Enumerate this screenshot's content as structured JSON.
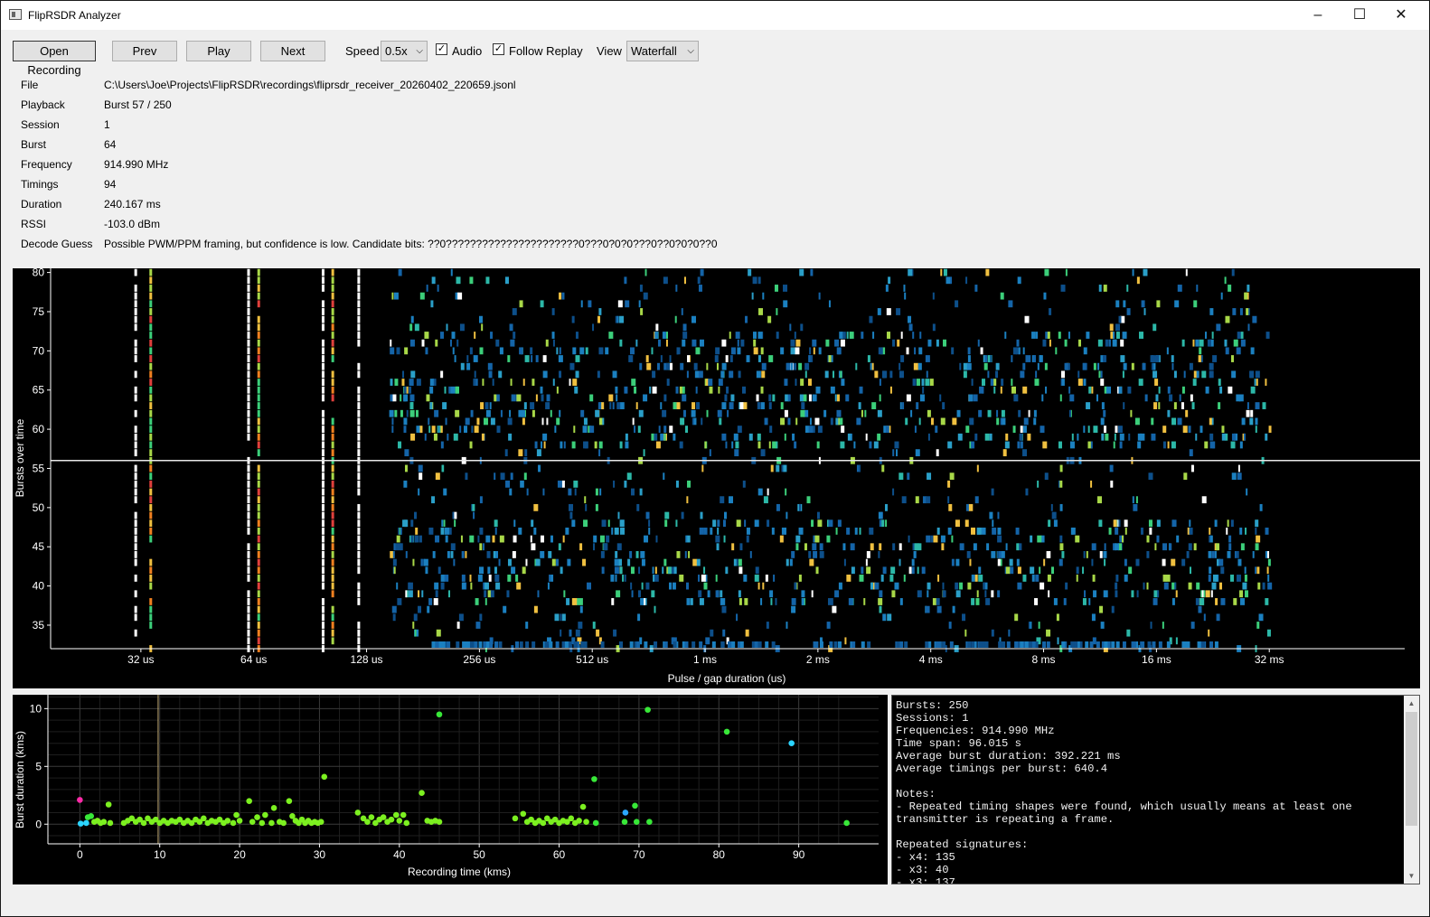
{
  "window": {
    "title": "FlipRSDR Analyzer",
    "minimize_glyph": "–",
    "maximize_glyph": "☐",
    "close_glyph": "✕"
  },
  "toolbar": {
    "open_label": "Open Recording",
    "prev_label": "Prev",
    "play_label": "Play",
    "next_label": "Next",
    "speed_label": "Speed",
    "speed_value": "0.5x",
    "audio_label": "Audio",
    "audio_checked": true,
    "follow_label": "Follow Replay",
    "follow_checked": true,
    "view_label": "View",
    "view_value": "Waterfall",
    "check_glyph": "✓",
    "dropdown_glyph": "⌵"
  },
  "info": {
    "file_label": "File",
    "file_value": "C:\\Users\\Joe\\Projects\\FlipRSDR\\recordings\\fliprsdr_receiver_20260402_220659.jsonl",
    "playback_label": "Playback",
    "playback_value": "Burst 57 / 250",
    "session_label": "Session",
    "session_value": "1",
    "burst_label": "Burst",
    "burst_value": "64",
    "frequency_label": "Frequency",
    "frequency_value": "914.990 MHz",
    "timings_label": "Timings",
    "timings_value": "94",
    "duration_label": "Duration",
    "duration_value": "240.167 ms",
    "rssi_label": "RSSI",
    "rssi_value": "-103.0 dBm",
    "decode_label": "Decode Guess",
    "decode_value": "Possible PWM/PPM framing, but confidence is low. Candidate bits: ??0??????????????????????0???0?0?0???0??0?0?0??0"
  },
  "waterfall": {
    "ylabel": "Bursts over time",
    "xlabel": "Pulse / gap duration (us)",
    "y_ticks": [
      "35",
      "40",
      "45",
      "50",
      "55",
      "60",
      "65",
      "70",
      "75",
      "80"
    ],
    "y_range": [
      32,
      80.3
    ],
    "x_ticks": [
      "32 us",
      "64 us",
      "128 us",
      "256 us",
      "512 us",
      "1 ms",
      "2 ms",
      "4 ms",
      "8 ms",
      "16 ms",
      "32 ms"
    ],
    "x_range_log2_us": [
      4.2,
      16.2
    ],
    "current_burst": 56,
    "colors": [
      "#0d4f8a",
      "#1464a8",
      "#1b80c0",
      "#2a9fc8",
      "#2cb8a8",
      "#3ccf7a",
      "#a8d848",
      "#f0c040",
      "#f08020",
      "#e0403c",
      "#ffffff"
    ]
  },
  "chart_data": [
    {
      "type": "heatmap",
      "title": "",
      "xlabel": "Pulse / gap duration (us)",
      "ylabel": "Bursts over time",
      "x_scale": "log2",
      "x_tick_labels": [
        "32 us",
        "64 us",
        "128 us",
        "256 us",
        "512 us",
        "1 ms",
        "2 ms",
        "4 ms",
        "8 ms",
        "16 ms",
        "32 ms"
      ],
      "y_range": [
        32,
        80
      ],
      "highlighted_burst": 56,
      "strong_columns_us": [
        31,
        34,
        62,
        66,
        98,
        104,
        122
      ]
    },
    {
      "type": "scatter",
      "title": "",
      "xlabel": "Recording time (kms)",
      "ylabel": "Burst duration (kms)",
      "xlim": [
        -4,
        100
      ],
      "ylim": [
        -1.7,
        11.2
      ],
      "x_ticks": [
        0,
        10,
        20,
        30,
        40,
        50,
        60,
        70,
        80,
        90
      ],
      "y_ticks": [
        0,
        5,
        10
      ],
      "cursor_x": 9.8,
      "points": [
        {
          "x": 0.0,
          "y": 2.1,
          "c": "#ff2aa8"
        },
        {
          "x": 0.1,
          "y": 0.05,
          "c": "#2bd4ff"
        },
        {
          "x": 0.8,
          "y": 0.1,
          "c": "#2bd4ff"
        },
        {
          "x": 1.0,
          "y": 0.6,
          "c": "#38e838"
        },
        {
          "x": 1.4,
          "y": 0.7,
          "c": "#38e838"
        },
        {
          "x": 1.8,
          "y": 0.2,
          "c": "#7cf020"
        },
        {
          "x": 2.2,
          "y": 0.3,
          "c": "#7cf020"
        },
        {
          "x": 2.6,
          "y": 0.1,
          "c": "#7cf020"
        },
        {
          "x": 3.0,
          "y": 0.2,
          "c": "#7cf020"
        },
        {
          "x": 3.6,
          "y": 1.7,
          "c": "#7cf020"
        },
        {
          "x": 3.8,
          "y": 0.1,
          "c": "#7cf020"
        },
        {
          "x": 5.5,
          "y": 0.1,
          "c": "#7cf020"
        },
        {
          "x": 6.0,
          "y": 0.3,
          "c": "#7cf020"
        },
        {
          "x": 6.5,
          "y": 0.5,
          "c": "#7cf020"
        },
        {
          "x": 7.0,
          "y": 0.2,
          "c": "#7cf020"
        },
        {
          "x": 7.5,
          "y": 0.4,
          "c": "#7cf020"
        },
        {
          "x": 8.0,
          "y": 0.1,
          "c": "#7cf020"
        },
        {
          "x": 8.5,
          "y": 0.5,
          "c": "#7cf020"
        },
        {
          "x": 9.0,
          "y": 0.2,
          "c": "#7cf020"
        },
        {
          "x": 9.5,
          "y": 0.4,
          "c": "#7cf020"
        },
        {
          "x": 10.0,
          "y": 0.1,
          "c": "#7cf020"
        },
        {
          "x": 10.5,
          "y": 0.3,
          "c": "#7cf020"
        },
        {
          "x": 11.0,
          "y": 0.1,
          "c": "#7cf020"
        },
        {
          "x": 11.5,
          "y": 0.3,
          "c": "#7cf020"
        },
        {
          "x": 12.0,
          "y": 0.2,
          "c": "#7cf020"
        },
        {
          "x": 12.5,
          "y": 0.4,
          "c": "#7cf020"
        },
        {
          "x": 13.0,
          "y": 0.1,
          "c": "#7cf020"
        },
        {
          "x": 13.5,
          "y": 0.3,
          "c": "#7cf020"
        },
        {
          "x": 14.0,
          "y": 0.1,
          "c": "#7cf020"
        },
        {
          "x": 14.5,
          "y": 0.4,
          "c": "#7cf020"
        },
        {
          "x": 15.0,
          "y": 0.2,
          "c": "#7cf020"
        },
        {
          "x": 15.5,
          "y": 0.5,
          "c": "#7cf020"
        },
        {
          "x": 16.0,
          "y": 0.1,
          "c": "#7cf020"
        },
        {
          "x": 16.5,
          "y": 0.3,
          "c": "#7cf020"
        },
        {
          "x": 17.0,
          "y": 0.2,
          "c": "#7cf020"
        },
        {
          "x": 17.5,
          "y": 0.4,
          "c": "#7cf020"
        },
        {
          "x": 18.0,
          "y": 0.1,
          "c": "#7cf020"
        },
        {
          "x": 18.5,
          "y": 0.3,
          "c": "#7cf020"
        },
        {
          "x": 19.2,
          "y": 0.1,
          "c": "#7cf020"
        },
        {
          "x": 19.6,
          "y": 0.8,
          "c": "#7cf020"
        },
        {
          "x": 20.0,
          "y": 0.3,
          "c": "#7cf020"
        },
        {
          "x": 21.2,
          "y": 2.0,
          "c": "#7cf020"
        },
        {
          "x": 21.6,
          "y": 0.2,
          "c": "#7cf020"
        },
        {
          "x": 22.2,
          "y": 0.6,
          "c": "#7cf020"
        },
        {
          "x": 22.8,
          "y": 0.1,
          "c": "#7cf020"
        },
        {
          "x": 23.2,
          "y": 0.8,
          "c": "#7cf020"
        },
        {
          "x": 24.0,
          "y": 0.1,
          "c": "#7cf020"
        },
        {
          "x": 24.3,
          "y": 1.4,
          "c": "#7cf020"
        },
        {
          "x": 25.0,
          "y": 0.2,
          "c": "#7cf020"
        },
        {
          "x": 25.5,
          "y": 0.1,
          "c": "#7cf020"
        },
        {
          "x": 26.2,
          "y": 2.0,
          "c": "#7cf020"
        },
        {
          "x": 26.6,
          "y": 0.7,
          "c": "#7cf020"
        },
        {
          "x": 27.0,
          "y": 0.3,
          "c": "#7cf020"
        },
        {
          "x": 27.4,
          "y": 0.1,
          "c": "#7cf020"
        },
        {
          "x": 27.8,
          "y": 0.4,
          "c": "#7cf020"
        },
        {
          "x": 28.2,
          "y": 0.1,
          "c": "#7cf020"
        },
        {
          "x": 28.6,
          "y": 0.3,
          "c": "#7cf020"
        },
        {
          "x": 29.0,
          "y": 0.1,
          "c": "#7cf020"
        },
        {
          "x": 29.4,
          "y": 0.2,
          "c": "#7cf020"
        },
        {
          "x": 29.8,
          "y": 0.1,
          "c": "#7cf020"
        },
        {
          "x": 30.2,
          "y": 0.2,
          "c": "#7cf020"
        },
        {
          "x": 30.6,
          "y": 4.1,
          "c": "#7cf020"
        },
        {
          "x": 34.8,
          "y": 1.0,
          "c": "#7cf020"
        },
        {
          "x": 35.5,
          "y": 0.5,
          "c": "#7cf020"
        },
        {
          "x": 36.0,
          "y": 0.2,
          "c": "#7cf020"
        },
        {
          "x": 36.5,
          "y": 0.6,
          "c": "#7cf020"
        },
        {
          "x": 37.0,
          "y": 0.1,
          "c": "#7cf020"
        },
        {
          "x": 37.5,
          "y": 0.4,
          "c": "#7cf020"
        },
        {
          "x": 38.0,
          "y": 0.6,
          "c": "#7cf020"
        },
        {
          "x": 38.5,
          "y": 0.2,
          "c": "#7cf020"
        },
        {
          "x": 39.0,
          "y": 0.4,
          "c": "#7cf020"
        },
        {
          "x": 39.6,
          "y": 0.8,
          "c": "#7cf020"
        },
        {
          "x": 40.0,
          "y": 0.3,
          "c": "#7cf020"
        },
        {
          "x": 40.5,
          "y": 0.8,
          "c": "#7cf020"
        },
        {
          "x": 40.9,
          "y": 0.1,
          "c": "#7cf020"
        },
        {
          "x": 42.8,
          "y": 2.7,
          "c": "#7cf020"
        },
        {
          "x": 43.5,
          "y": 0.3,
          "c": "#7cf020"
        },
        {
          "x": 44.0,
          "y": 0.2,
          "c": "#7cf020"
        },
        {
          "x": 44.5,
          "y": 0.3,
          "c": "#7cf020"
        },
        {
          "x": 45.0,
          "y": 0.2,
          "c": "#7cf020"
        },
        {
          "x": 45.0,
          "y": 9.5,
          "c": "#38e838"
        },
        {
          "x": 54.5,
          "y": 0.5,
          "c": "#7cf020"
        },
        {
          "x": 55.5,
          "y": 0.9,
          "c": "#7cf020"
        },
        {
          "x": 56.0,
          "y": 0.2,
          "c": "#7cf020"
        },
        {
          "x": 56.5,
          "y": 0.4,
          "c": "#7cf020"
        },
        {
          "x": 57.0,
          "y": 0.1,
          "c": "#7cf020"
        },
        {
          "x": 57.5,
          "y": 0.3,
          "c": "#7cf020"
        },
        {
          "x": 58.0,
          "y": 0.1,
          "c": "#7cf020"
        },
        {
          "x": 58.5,
          "y": 0.5,
          "c": "#7cf020"
        },
        {
          "x": 59.0,
          "y": 0.2,
          "c": "#7cf020"
        },
        {
          "x": 59.5,
          "y": 0.4,
          "c": "#7cf020"
        },
        {
          "x": 60.0,
          "y": 0.1,
          "c": "#7cf020"
        },
        {
          "x": 60.5,
          "y": 0.3,
          "c": "#7cf020"
        },
        {
          "x": 61.0,
          "y": 0.2,
          "c": "#7cf020"
        },
        {
          "x": 61.5,
          "y": 0.5,
          "c": "#7cf020"
        },
        {
          "x": 62.0,
          "y": 0.1,
          "c": "#7cf020"
        },
        {
          "x": 62.5,
          "y": 0.3,
          "c": "#7cf020"
        },
        {
          "x": 63.0,
          "y": 1.5,
          "c": "#7cf020"
        },
        {
          "x": 63.4,
          "y": 0.2,
          "c": "#7cf020"
        },
        {
          "x": 64.4,
          "y": 3.9,
          "c": "#38e838"
        },
        {
          "x": 64.6,
          "y": 0.1,
          "c": "#38e838"
        },
        {
          "x": 68.3,
          "y": 1.0,
          "c": "#2ba8ff"
        },
        {
          "x": 68.2,
          "y": 0.2,
          "c": "#38e838"
        },
        {
          "x": 69.5,
          "y": 1.6,
          "c": "#38e838"
        },
        {
          "x": 69.7,
          "y": 0.2,
          "c": "#38e838"
        },
        {
          "x": 71.1,
          "y": 9.9,
          "c": "#38e838"
        },
        {
          "x": 71.3,
          "y": 0.2,
          "c": "#38e838"
        },
        {
          "x": 81.0,
          "y": 8.0,
          "c": "#38e838"
        },
        {
          "x": 89.1,
          "y": 7.0,
          "c": "#2bd4ff"
        },
        {
          "x": 96.0,
          "y": 0.1,
          "c": "#38e838"
        }
      ]
    }
  ],
  "scatter": {
    "xlabel": "Recording time (kms)",
    "ylabel": "Burst duration (kms)",
    "x_ticks": [
      "0",
      "10",
      "20",
      "30",
      "40",
      "50",
      "60",
      "70",
      "80",
      "90"
    ],
    "y_ticks": [
      "0",
      "5",
      "10"
    ]
  },
  "summary": {
    "text": "Bursts: 250\nSessions: 1\nFrequencies: 914.990 MHz\nTime span: 96.015 s\nAverage burst duration: 392.221 ms\nAverage timings per burst: 640.4\n\nNotes:\n- Repeated timing shapes were found, which usually means at least one\ntransmitter is repeating a frame.\n\nRepeated signatures:\n- x4: 135\n- x3: 40\n- x3: 137",
    "scroll_up_glyph": "▲",
    "scroll_down_glyph": "▼"
  }
}
